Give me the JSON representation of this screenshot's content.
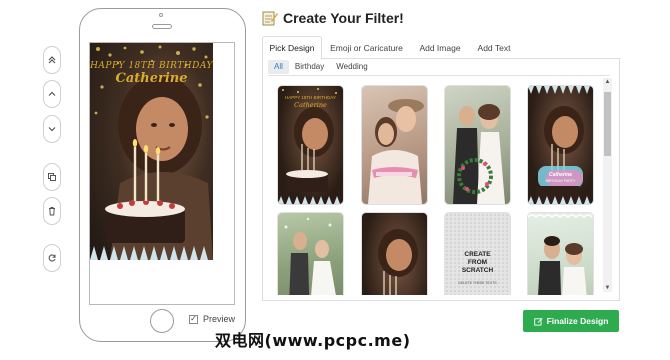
{
  "header": {
    "title": "Create Your Filter!",
    "icon": "notepad-pencil-icon"
  },
  "tabs": [
    {
      "label": "Pick Design",
      "active": true
    },
    {
      "label": "Emoji or Caricature",
      "active": false
    },
    {
      "label": "Add Image",
      "active": false
    },
    {
      "label": "Add Text",
      "active": false
    }
  ],
  "subtabs": [
    {
      "label": "All",
      "active": true
    },
    {
      "label": "Birthday",
      "active": false
    },
    {
      "label": "Wedding",
      "active": false
    }
  ],
  "tools": [
    "chevron-double-up-icon",
    "chevron-up-icon",
    "chevron-down-icon",
    "copy-icon",
    "trash-icon",
    "refresh-icon"
  ],
  "preview": {
    "line1": "HAPPY 18TH BIRTHDAY",
    "line2": "Catherine",
    "checkbox_label": "Preview",
    "checked": true
  },
  "designs": [
    {
      "caption1": "HAPPY 18TH BIRTHDAY",
      "caption2": "Catherine"
    },
    {
      "caption1": ""
    },
    {
      "caption1": ""
    },
    {
      "caption1": "Catherine",
      "caption2": "BIRTHDAY PARTY"
    },
    {
      "caption1": ""
    },
    {
      "caption1": ""
    },
    {
      "caption1": "CREATE FROM SCRATCH",
      "caption2": "DELETE THESE TEXTS"
    },
    {
      "caption1": ""
    }
  ],
  "finalize_label": "Finalize Design",
  "watermark": "双电网(www.pcpc.me)",
  "colors": {
    "accent": "#2eaa4f",
    "link": "#337ab7",
    "gold": "#d9ad2b"
  }
}
